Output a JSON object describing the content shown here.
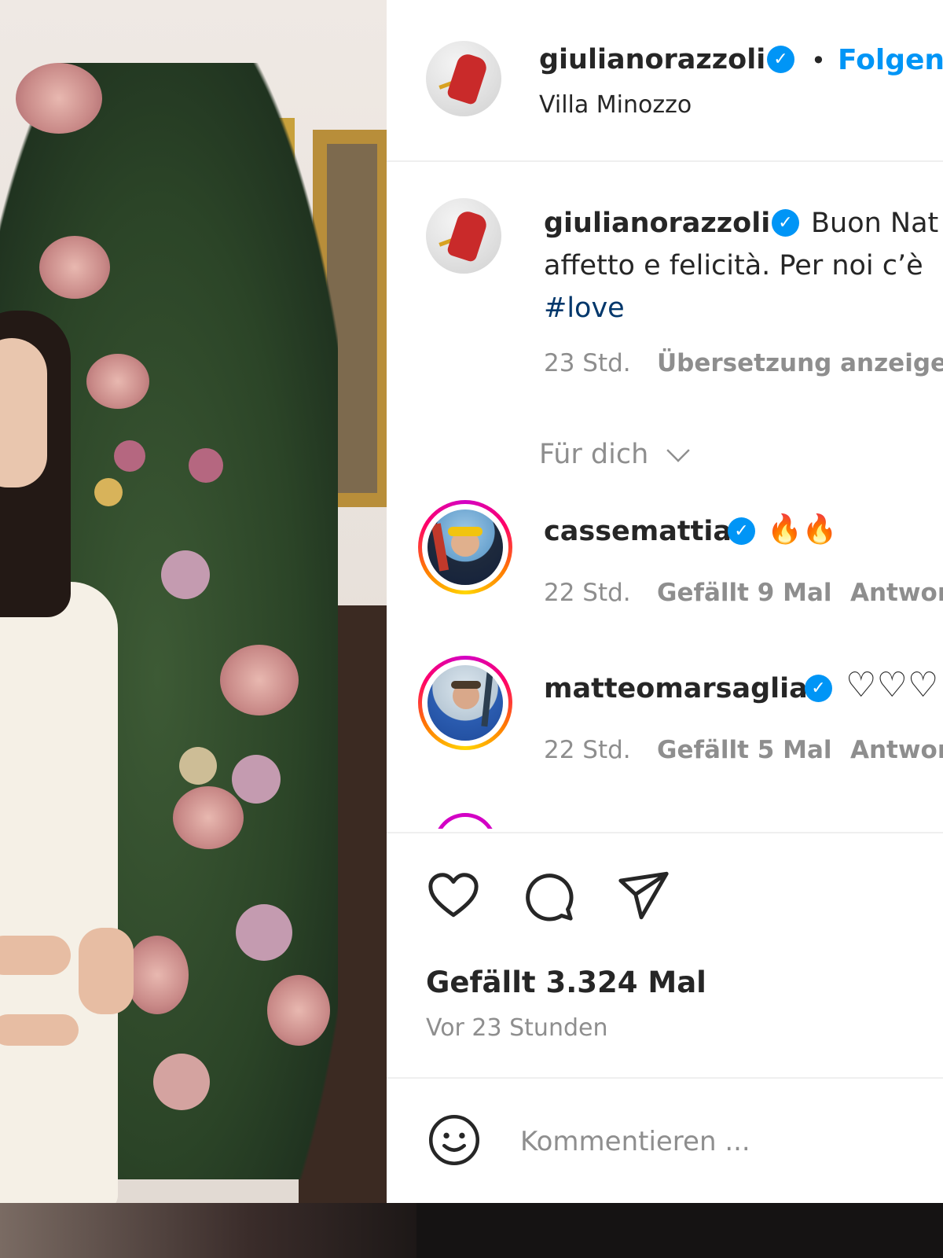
{
  "post": {
    "author": {
      "username": "giulianorazzoli",
      "verified_glyph": "✓",
      "follow_label": "Folgen",
      "separator": "•",
      "location": "Villa Minozzo"
    },
    "caption": {
      "username": "giulianorazzoli",
      "line1": "Buon Nat",
      "line2": "affetto e felicità. Per noi c’è",
      "hashtag": "#love",
      "time": "23 Std.",
      "translate_label": "Übersetzung anzeigen"
    },
    "filter": {
      "label": "Für dich",
      "icon": "chevron-down-icon"
    },
    "comments": [
      {
        "username": "cassemattia",
        "text": "🔥🔥",
        "time": "22 Std.",
        "likes": "Gefällt 9 Mal",
        "reply": "Antwor"
      },
      {
        "username": "matteomarsaglia",
        "text": "♡♡♡",
        "time": "22 Std.",
        "likes": "Gefällt 5 Mal",
        "reply": "Antwor"
      }
    ],
    "likes_label": "Gefällt 3.324 Mal",
    "posted_ago": "Vor 23 Stunden",
    "comment_placeholder": "Kommentieren ...",
    "actions": [
      "heart-icon",
      "comment-icon",
      "share-icon"
    ]
  },
  "colors": {
    "accent": "#0095f6",
    "text": "#262626",
    "muted": "#8e8e8e",
    "hashtag": "#00376b"
  }
}
